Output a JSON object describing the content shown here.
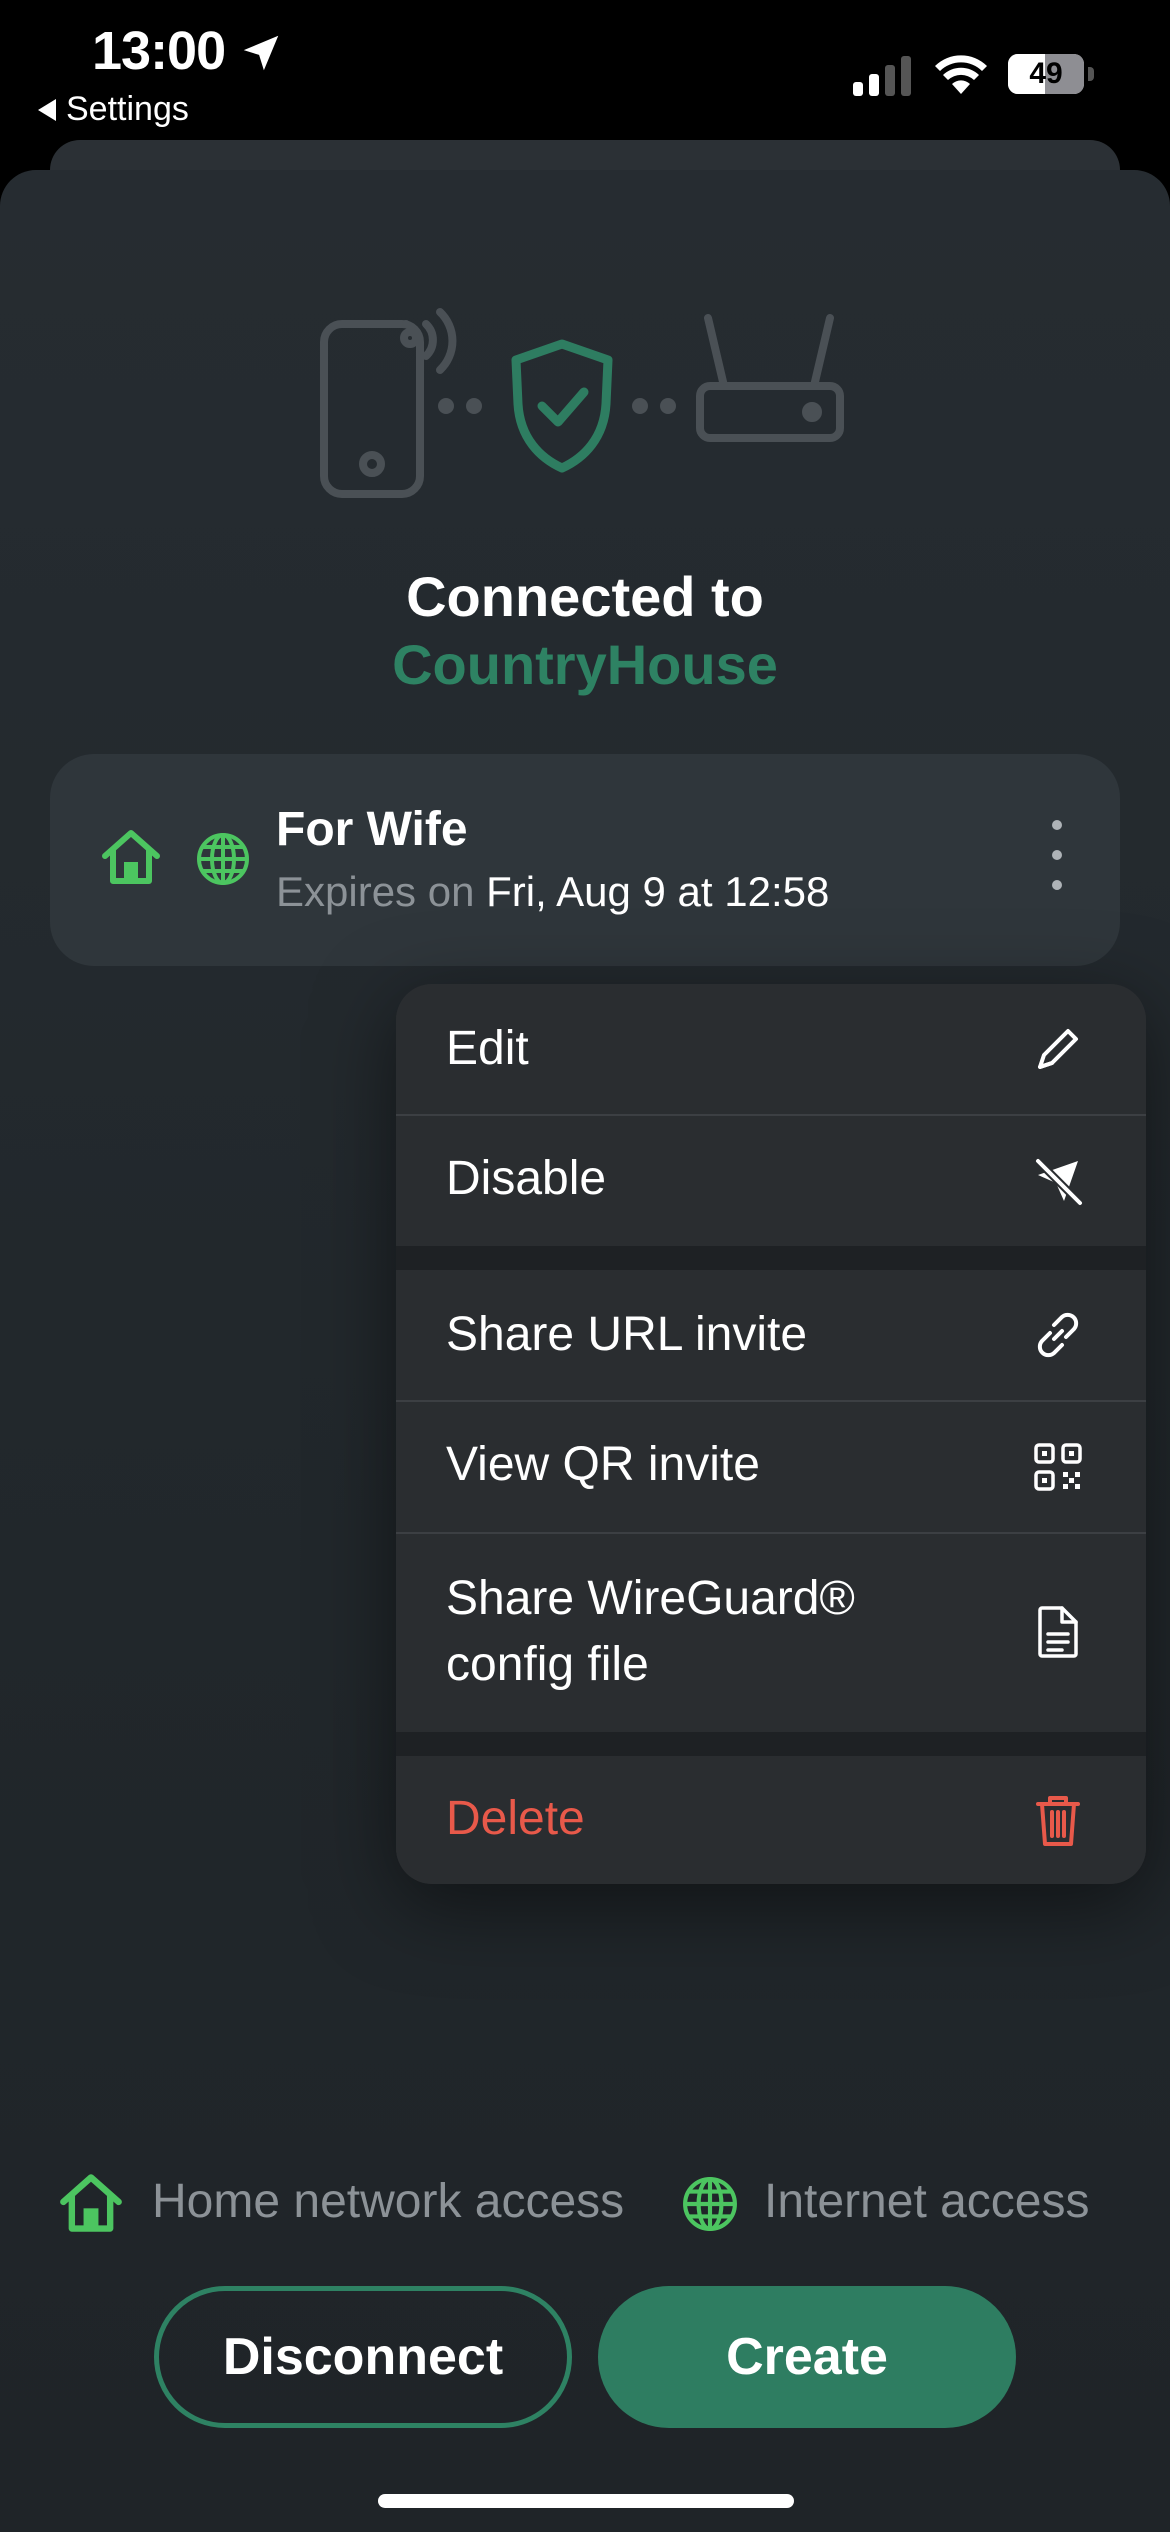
{
  "status_bar": {
    "time": "13:00",
    "back_app": "Settings",
    "battery": "49",
    "battery_level": 0.49
  },
  "hero": {
    "title": "Connected to",
    "network": "CountryHouse"
  },
  "invite": {
    "name": "For Wife",
    "expires_label": "Expires on",
    "expires_value": "Fri, Aug 9 at 12:58"
  },
  "menu": {
    "edit": "Edit",
    "disable": "Disable",
    "share_url": "Share URL invite",
    "view_qr": "View QR invite",
    "share_config_line1": "Share WireGuard®",
    "share_config_line2": "config file",
    "delete": "Delete"
  },
  "legend": {
    "home": "Home network access",
    "internet": "Internet access"
  },
  "actions": {
    "disconnect": "Disconnect",
    "create": "Create"
  },
  "colors": {
    "accent": "#2e8263",
    "icon_green": "#4cc560",
    "destructive": "#e8594a"
  },
  "icons": {
    "location": "location-arrow-icon",
    "home": "home-icon",
    "globe": "globe-icon",
    "more": "more-vertical-icon",
    "edit": "pencil-icon",
    "disable": "paper-plane-slash-icon",
    "share_url": "link-icon",
    "view_qr": "qr-code-icon",
    "config": "document-icon",
    "delete": "trash-icon"
  }
}
